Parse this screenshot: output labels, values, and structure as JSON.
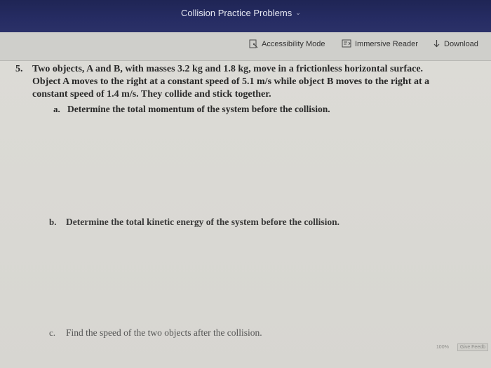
{
  "window": {
    "title": "Collision Practice Problems"
  },
  "toolbar": {
    "accessibility_label": "Accessibility Mode",
    "immersive_label": "Immersive Reader",
    "download_label": "Download"
  },
  "question": {
    "number": "5.",
    "lines": [
      "Two objects, A and B, with masses 3.2 kg and 1.8 kg, move in a frictionless horizontal surface.",
      "Object A moves to the right at a constant speed of 5.1 m/s while object B moves to the right at a",
      "constant speed of 1.4 m/s. They collide and stick together."
    ],
    "parts": [
      {
        "letter": "a.",
        "text": "Determine the total momentum of the system before the collision."
      },
      {
        "letter": "b.",
        "text": "Determine the total kinetic energy of the system before the collision."
      },
      {
        "letter": "c.",
        "text": "Find the speed of the two objects after the collision."
      }
    ]
  },
  "footer": {
    "zoom": "100%",
    "feedback": "Give Feedb"
  }
}
